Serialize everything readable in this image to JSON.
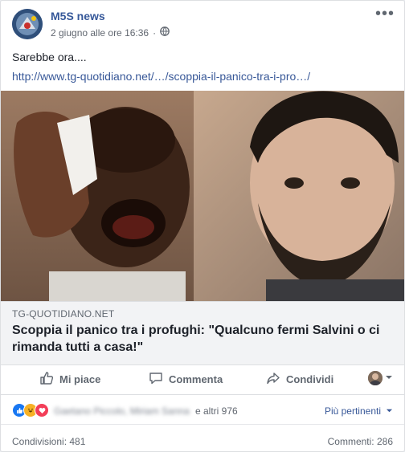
{
  "post": {
    "page_name": "M5S news",
    "timestamp": "2 giugno alle ore 16:36",
    "audience_icon": "globe-icon",
    "text": "Sarebbe ora....",
    "link_url": "http://www.tg-quotidiano.net/…/scoppia-il-panico-tra-i-pro…/"
  },
  "link_preview": {
    "domain": "TG-QUOTIDIANO.NET",
    "title": "Scoppia il panico tra i profughi: \"Qualcuno fermi Salvini o ci rimanda tutti a casa!\""
  },
  "actions": {
    "like_label": "Mi piace",
    "comment_label": "Commenta",
    "share_label": "Condividi"
  },
  "reactions": {
    "types": [
      "like-icon",
      "haha-icon",
      "love-icon"
    ],
    "names_blurred": "Gaetano Piccolo, Miriam Sanna",
    "others_label": "e altri 976",
    "sort_label": "Più pertinenti"
  },
  "footer": {
    "shares_label": "Condivisioni: 481",
    "comments_label": "Commenti: 286"
  },
  "colors": {
    "link": "#385898",
    "page_name": "#365899",
    "like": "#1877f2",
    "haha": "#f7b125",
    "love": "#f33e58"
  }
}
